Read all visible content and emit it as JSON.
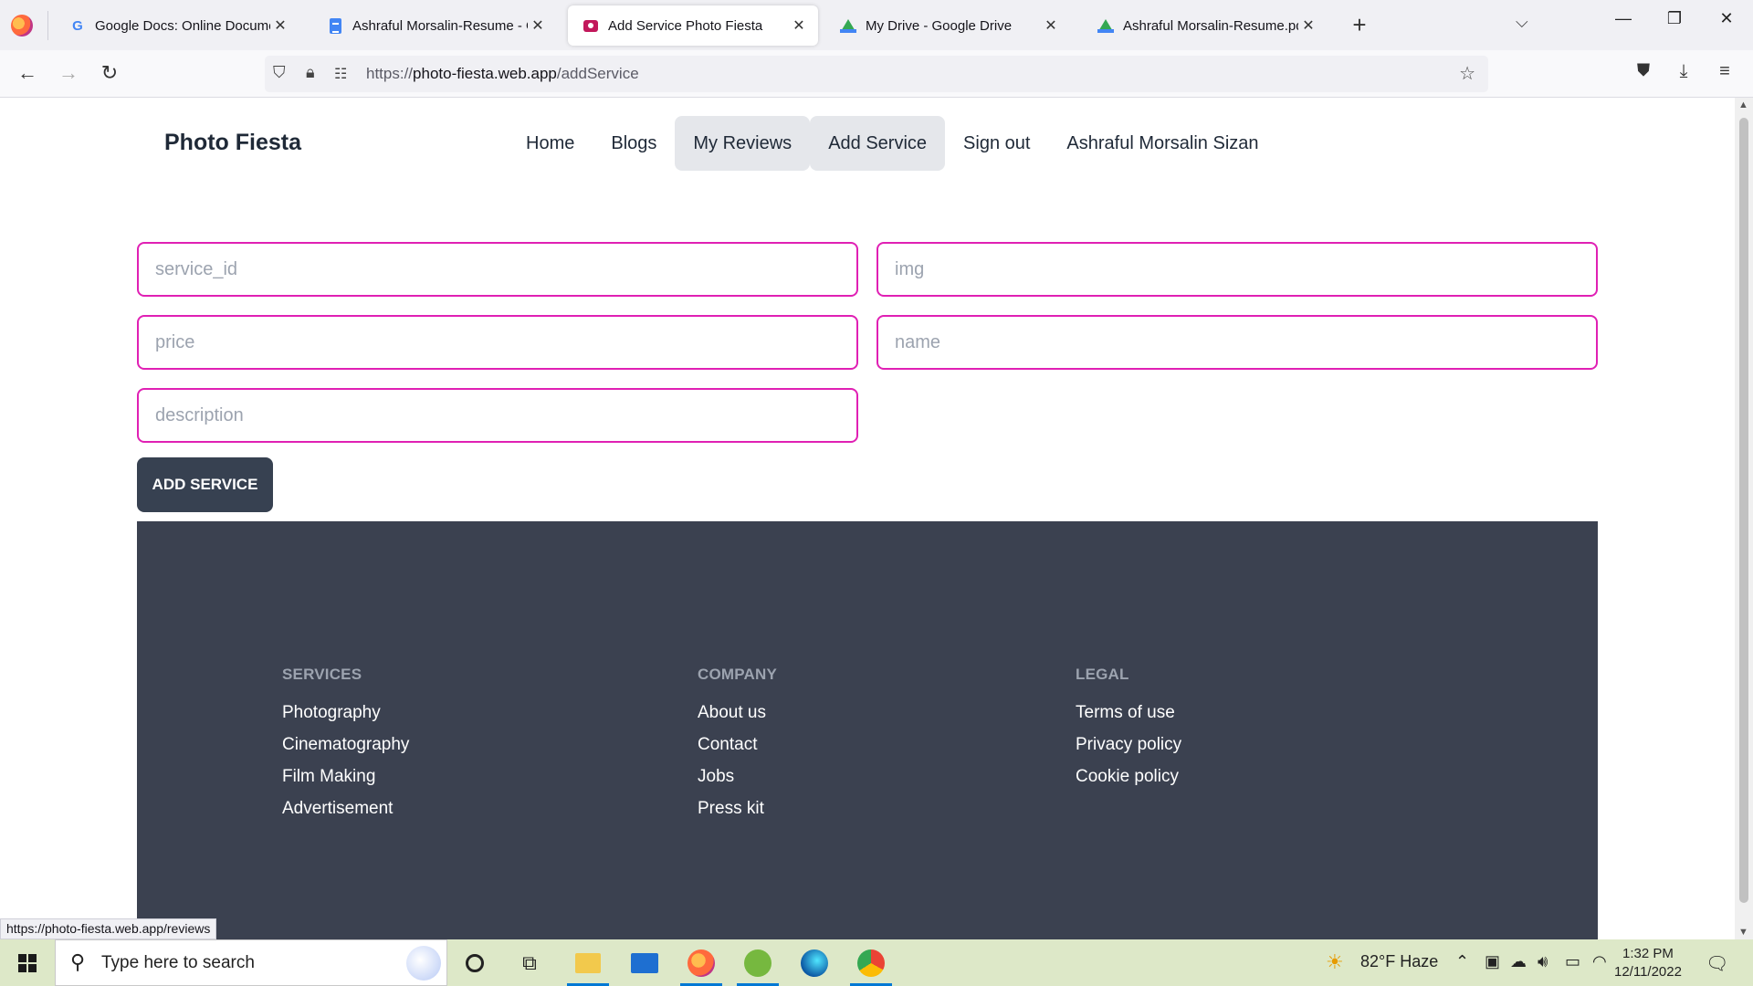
{
  "browser": {
    "tabs": [
      {
        "title": "Google Docs: Online Document",
        "icon": "google-icon"
      },
      {
        "title": "Ashraful Morsalin-Resume - Go",
        "icon": "docs-icon"
      },
      {
        "title": "Add Service Photo Fiesta",
        "icon": "camera-icon",
        "active": true
      },
      {
        "title": "My Drive - Google Drive",
        "icon": "drive-icon"
      },
      {
        "title": "Ashraful Morsalin-Resume.pdf -",
        "icon": "drive-icon"
      }
    ],
    "url_prefix": "https://",
    "url_host": "photo-fiesta.web.app",
    "url_path": "/addService"
  },
  "site": {
    "brand": "Photo Fiesta",
    "menu": [
      "Home",
      "Blogs",
      "My Reviews",
      "Add Service",
      "Sign out"
    ],
    "user_name": "Ashraful Morsalin Sizan"
  },
  "form": {
    "service_id_placeholder": "service_id",
    "img_placeholder": "img",
    "price_placeholder": "price",
    "name_placeholder": "name",
    "description_placeholder": "description",
    "submit_label": "ADD SERVICE",
    "border_color": "#e020b4"
  },
  "footer": {
    "services": {
      "heading": "SERVICES",
      "links": [
        "Photography",
        "Cinematography",
        "Film Making",
        "Advertisement"
      ]
    },
    "company": {
      "heading": "COMPANY",
      "links": [
        "About us",
        "Contact",
        "Jobs",
        "Press kit"
      ]
    },
    "legal": {
      "heading": "LEGAL",
      "links": [
        "Terms of use",
        "Privacy policy",
        "Cookie policy"
      ]
    }
  },
  "status_link": "https://photo-fiesta.web.app/reviews",
  "taskbar": {
    "search_placeholder": "Type here to search",
    "weather": "82°F  Haze",
    "time": "1:32 PM",
    "date": "12/11/2022"
  }
}
